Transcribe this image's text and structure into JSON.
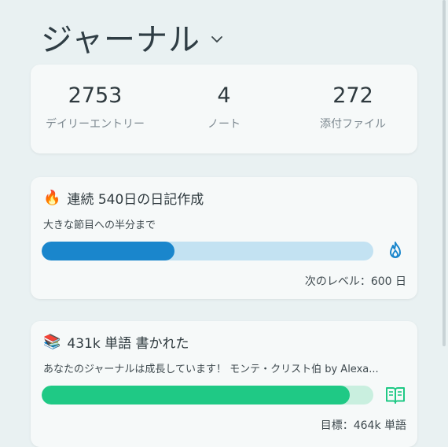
{
  "header": {
    "title": "ジャーナル"
  },
  "stats": [
    {
      "value": "2753",
      "label": "デイリーエントリー"
    },
    {
      "value": "4",
      "label": "ノート"
    },
    {
      "value": "272",
      "label": "添付ファイル"
    }
  ],
  "streak": {
    "title": "連続 540日の日記作成",
    "subtitle": "大きな節目への半分まで",
    "progress": 0.4,
    "footer": "次のレベル：600 日",
    "color": "#1a86cc",
    "track_color": "#c3e2f2"
  },
  "words": {
    "title": "431k 単語 書かれた",
    "subtitle": "あなたのジャーナルは成長しています！ モンテ・クリスト伯 by Alexa...",
    "progress": 0.93,
    "footer": "目標：464k 単語",
    "color": "#1fc985",
    "track_color": "#c9efdf"
  },
  "icons": {
    "streak_emoji": "fire-icon",
    "words_emoji": "books-icon",
    "streak_bar": "flame-outline-icon",
    "words_bar": "open-book-icon"
  }
}
